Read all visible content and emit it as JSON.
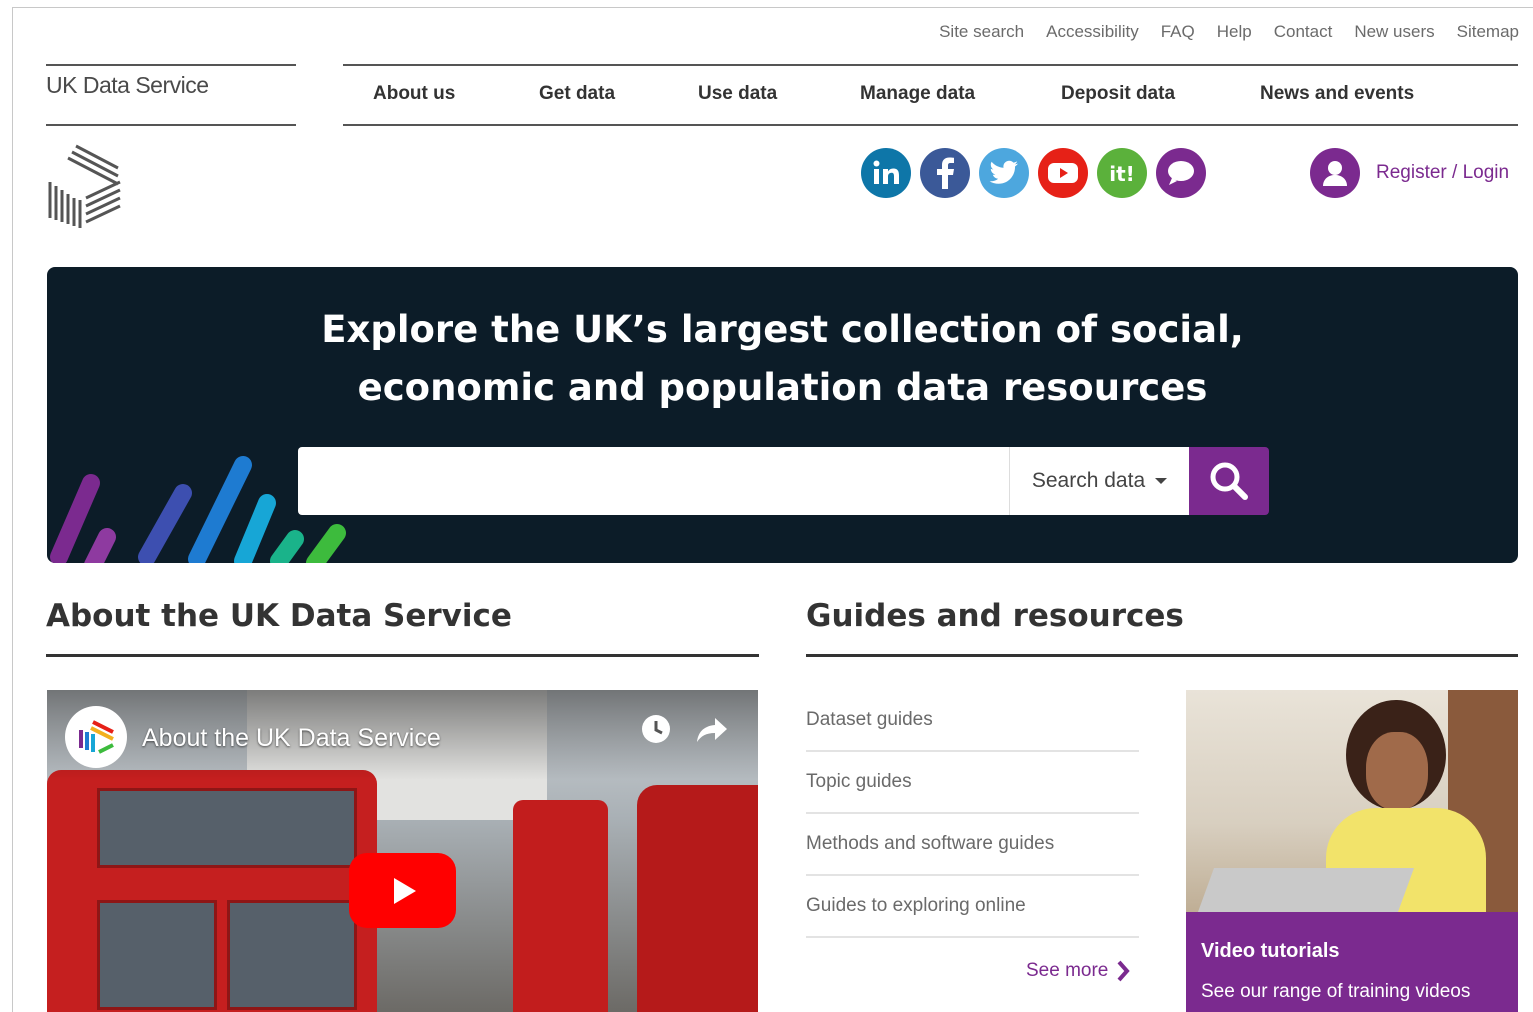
{
  "utility_links": [
    "Site search",
    "Accessibility",
    "FAQ",
    "Help",
    "Contact",
    "New users",
    "Sitemap"
  ],
  "brand": {
    "name": "UK Data Service"
  },
  "main_nav": [
    "About us",
    "Get data",
    "Use data",
    "Manage data",
    "Deposit data",
    "News and events"
  ],
  "social": [
    {
      "icon": "linkedin-icon",
      "color": "#0e76a8"
    },
    {
      "icon": "facebook-icon",
      "color": "#3b5998"
    },
    {
      "icon": "twitter-icon",
      "color": "#4da7de"
    },
    {
      "icon": "youtube-icon",
      "color": "#e62117"
    },
    {
      "icon": "jiscmail-icon",
      "color": "#5bb13b"
    },
    {
      "icon": "chat-icon",
      "color": "#7b2a8f"
    }
  ],
  "account": {
    "label": "Register / Login"
  },
  "hero": {
    "title": "Explore the UK’s largest collection of social, economic and population data resources",
    "search_placeholder": "",
    "search_scope": "Search data"
  },
  "about": {
    "title": "About the UK Data Service",
    "video_title": "About the UK Data Service"
  },
  "guides": {
    "title": "Guides and resources",
    "items": [
      "Dataset guides",
      "Topic guides",
      "Methods and software guides",
      "Guides to exploring online"
    ],
    "see_more": "See more"
  },
  "promo": {
    "title": "Video tutorials",
    "subtitle": "See our range of training videos"
  },
  "colors": {
    "brand_purple": "#7b2a8f",
    "hero_bg": "#0c1c28"
  }
}
